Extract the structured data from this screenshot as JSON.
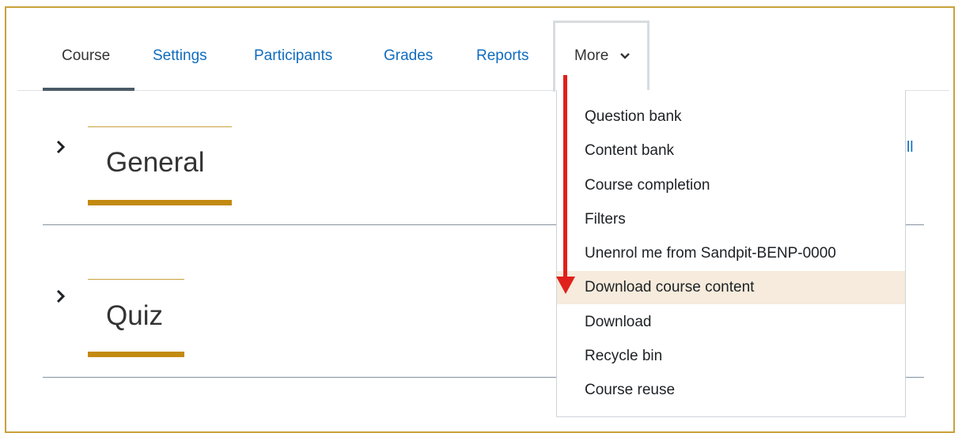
{
  "nav": {
    "tabs": [
      {
        "label": "Course"
      },
      {
        "label": "Settings"
      },
      {
        "label": "Participants"
      },
      {
        "label": "Grades"
      },
      {
        "label": "Reports"
      }
    ],
    "more_label": "More",
    "more_chevron": "⌄"
  },
  "sections": [
    {
      "title": "General",
      "chevron": "›"
    },
    {
      "title": "Quiz",
      "chevron": "›"
    }
  ],
  "collapse_all_partial": "ll",
  "dropdown": {
    "items": [
      {
        "label": "Question bank"
      },
      {
        "label": "Content bank"
      },
      {
        "label": "Course completion"
      },
      {
        "label": "Filters"
      },
      {
        "label": "Unenrol me from Sandpit-BENP-0000"
      },
      {
        "label": "Download course content"
      },
      {
        "label": "Download"
      },
      {
        "label": "Recycle bin"
      },
      {
        "label": "Course reuse"
      }
    ],
    "highlighted_index": 5
  },
  "colors": {
    "link": "#0f6cbf",
    "accent_gold": "#c38a11",
    "highlight": "#f6ebdc",
    "annotation_arrow": "#e0201b",
    "frame": "#c8a23c"
  },
  "icons": {
    "more": "chevron-down-icon",
    "section": "chevron-right-icon",
    "annotation": "arrow-down-icon"
  }
}
